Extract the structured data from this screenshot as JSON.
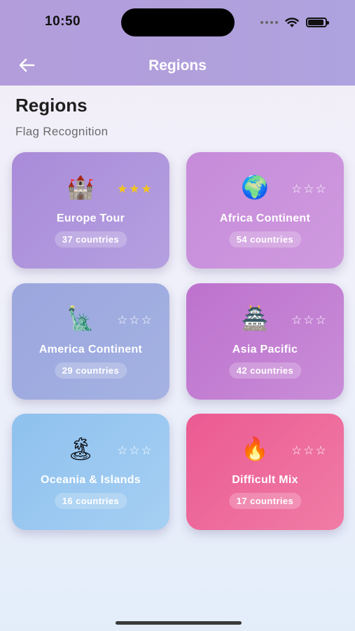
{
  "status_bar": {
    "time": "10:50"
  },
  "nav": {
    "title": "Regions"
  },
  "header": {
    "title": "Regions",
    "subtitle": "Flag Recognition"
  },
  "cards": [
    {
      "name": "Europe Tour",
      "count": "37 countries",
      "emoji": "🏰",
      "stars": "★★★",
      "stars_filled": 3,
      "icon": "castle-icon"
    },
    {
      "name": "Africa Continent",
      "count": "54 countries",
      "emoji": "🌍",
      "stars": "☆☆☆",
      "stars_filled": 0,
      "icon": "globe-africa-icon"
    },
    {
      "name": "America Continent",
      "count": "29 countries",
      "emoji": "🗽",
      "stars": "☆☆☆",
      "stars_filled": 0,
      "icon": "statue-of-liberty-icon"
    },
    {
      "name": "Asia Pacific",
      "count": "42 countries",
      "emoji": "🏯",
      "stars": "☆☆☆",
      "stars_filled": 0,
      "icon": "japanese-castle-icon"
    },
    {
      "name": "Oceania & Islands",
      "count": "16 countries",
      "emoji": "🏝",
      "stars": "☆☆☆",
      "stars_filled": 0,
      "icon": "island-icon"
    },
    {
      "name": "Difficult Mix",
      "count": "17 countries",
      "emoji": "🔥",
      "stars": "☆☆☆",
      "stars_filled": 0,
      "icon": "fire-icon"
    }
  ],
  "colors": {
    "topbar": "#b39ddb",
    "star_filled": "#f5c518",
    "star_empty": "#ffffff"
  }
}
